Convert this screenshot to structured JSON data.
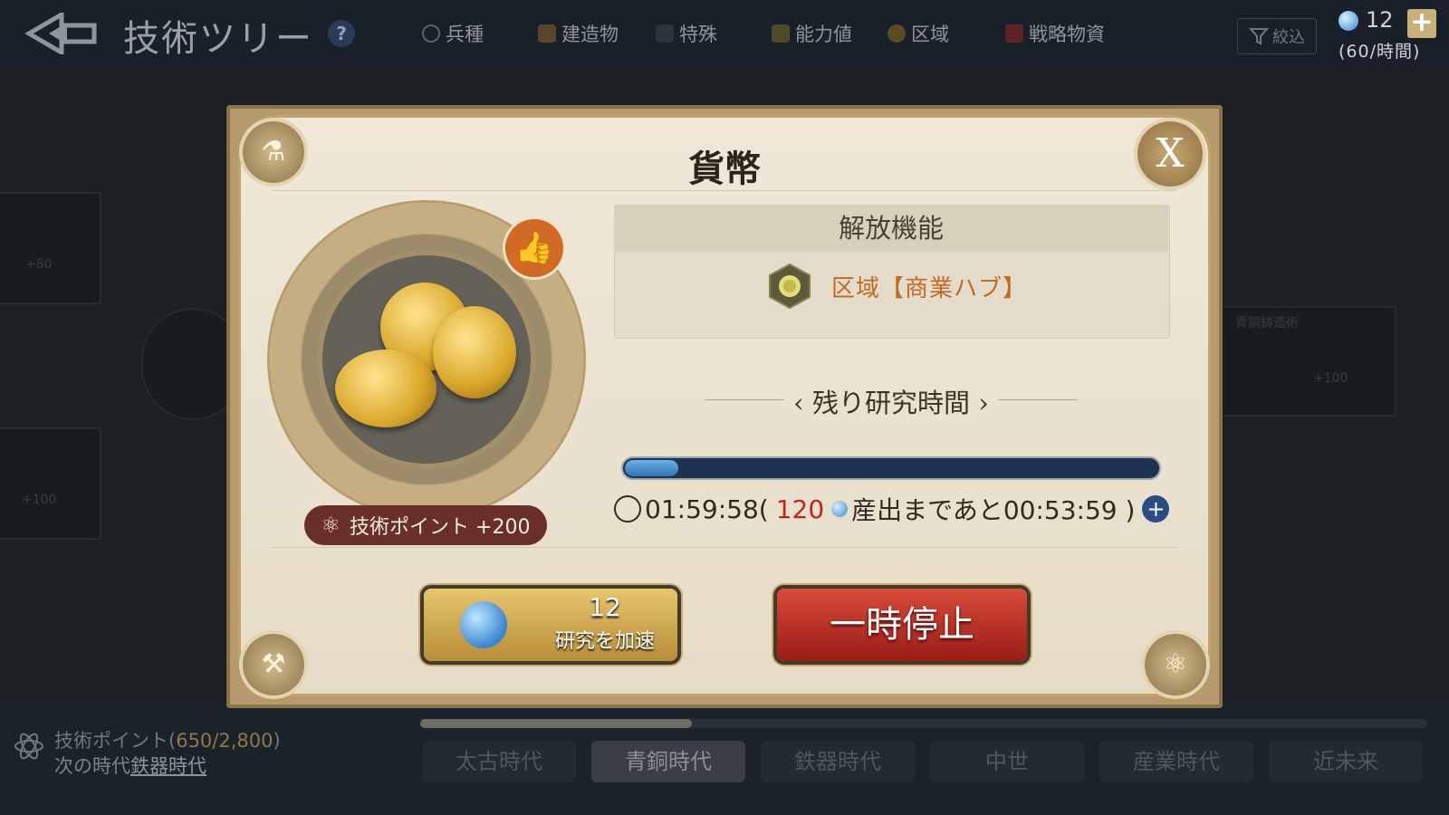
{
  "header": {
    "title": "技術ツリー",
    "help": "?",
    "filters": [
      {
        "label": "兵種",
        "color": "#1c2127"
      },
      {
        "label": "建造物",
        "color": "#5a4628"
      },
      {
        "label": "特殊",
        "color": "#2d333c"
      },
      {
        "label": "能力値",
        "color": "#4f4a2a"
      },
      {
        "label": "区域",
        "color": "#5c4a20"
      },
      {
        "label": "戦略物資",
        "color": "#5c2424"
      }
    ],
    "narrow_label": "絞込",
    "currency_value": "12",
    "currency_rate": "(60/時間)"
  },
  "tree": {
    "nodes": [
      "+80",
      "+100",
      "+100"
    ],
    "partial_label": "青銅鋳造術"
  },
  "footer": {
    "tech_points_prefix": "技術ポイント(",
    "tech_points_value": "650/2,800",
    "tech_points_suffix": ")",
    "next_era_prefix": "次の時代",
    "next_era": "鉄器時代",
    "era_progress": 0.27,
    "eras": [
      "太古時代",
      "青銅時代",
      "鉄器時代",
      "中世",
      "産業時代",
      "近未来"
    ],
    "active_era_index": 1
  },
  "modal": {
    "title": "貨幣",
    "close": "X",
    "tech_points_badge": "技術ポイント +200",
    "unlock_header": "解放機能",
    "unlock_item": "区域【商業ハブ】",
    "remaining_label": "残り研究時間",
    "progress": 0.1,
    "timer": "01:59:58(",
    "timer_cost": "120",
    "timer_suffix": "産出まであと00:53:59 )",
    "speedup_cost": "12",
    "speedup_label": "研究を加速",
    "pause_label": "一時停止"
  },
  "colors": {
    "accent_gold": "#c8b07a",
    "pause_red": "#c0271f",
    "unlock_orange": "#c26a1f",
    "progress_blue": "#2f75b6"
  }
}
